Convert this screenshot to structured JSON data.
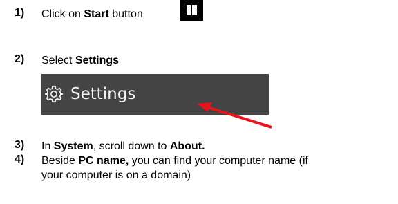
{
  "steps": [
    {
      "number": "1)",
      "text_before": "Click on ",
      "bold": "Start",
      "text_after": " button"
    },
    {
      "number": "2)",
      "text_before": "Select ",
      "bold": "Settings"
    },
    {
      "number": "3)",
      "text_before": "In ",
      "bold": "System",
      "text_middle": ", scroll down to ",
      "bold2": "About."
    },
    {
      "number": "4)",
      "text_before": "Beside ",
      "bold": "PC name,",
      "text_after": " you can find your computer name (if",
      "line2": "your computer is on a domain)"
    }
  ],
  "settings_screenshot": {
    "label": "Settings",
    "icon": "gear-icon",
    "background": "#444444",
    "text_color": "#f2f2f2",
    "arrow_color": "#e8131b"
  },
  "start_button_icon": "windows-logo-icon"
}
